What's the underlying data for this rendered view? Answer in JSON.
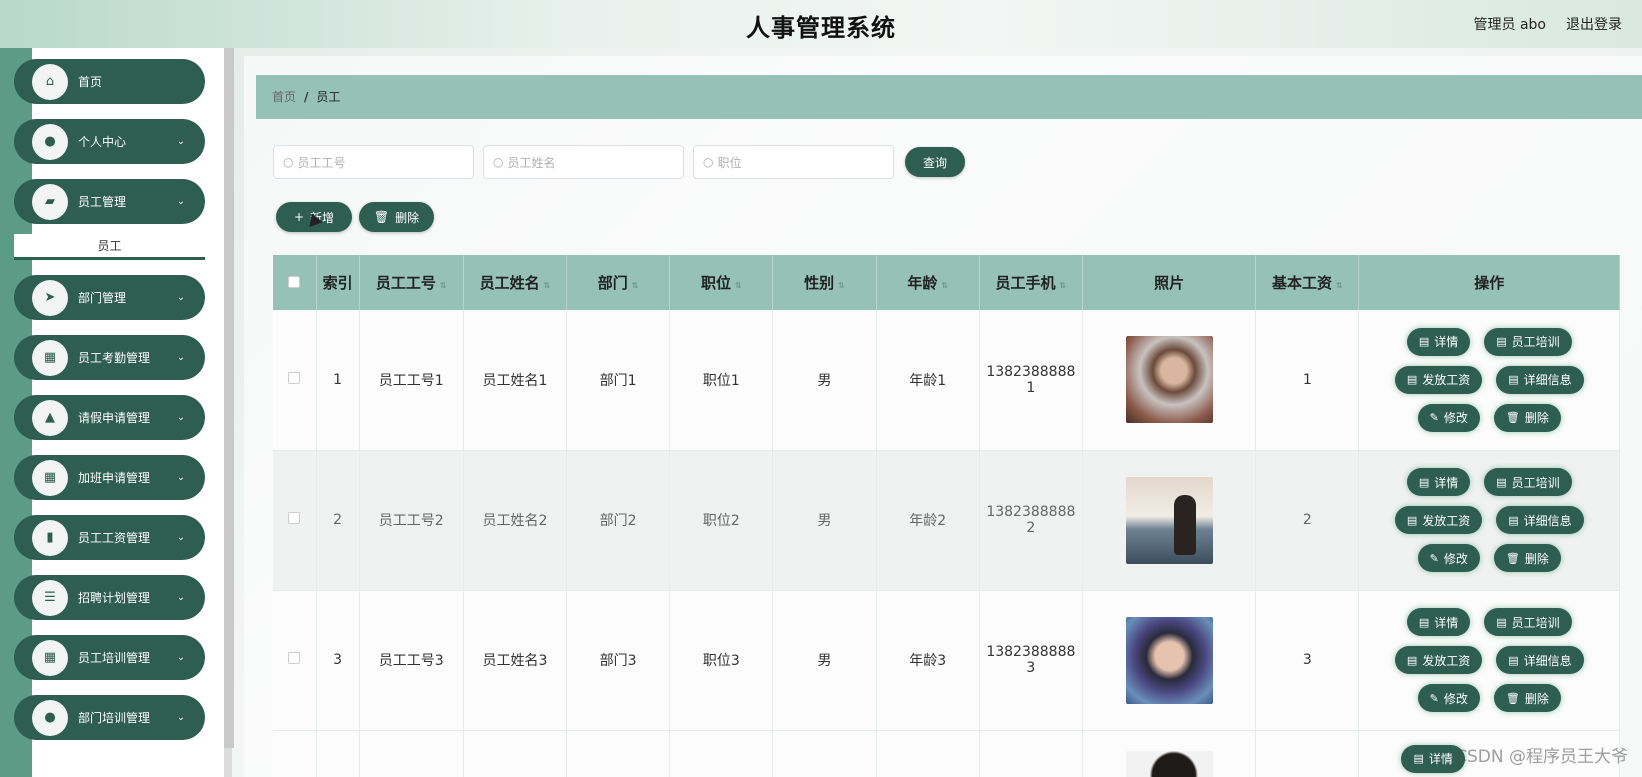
{
  "header": {
    "title": "人事管理系统",
    "user_label": "管理员 abo",
    "logout_label": "退出登录"
  },
  "sidebar": {
    "items": [
      {
        "label": "首页",
        "icon": "home-icon",
        "glyph": "⌂",
        "chevron": false
      },
      {
        "label": "个人中心",
        "icon": "user-icon",
        "glyph": "●",
        "chevron": true
      },
      {
        "label": "员工管理",
        "icon": "briefcase-icon",
        "glyph": "▰",
        "chevron": true
      },
      {
        "label": "部门管理",
        "icon": "send-icon",
        "glyph": "➤",
        "chevron": true
      },
      {
        "label": "员工考勤管理",
        "icon": "grid-icon",
        "glyph": "▦",
        "chevron": true
      },
      {
        "label": "请假申请管理",
        "icon": "stamp-icon",
        "glyph": "▲",
        "chevron": true
      },
      {
        "label": "加班申请管理",
        "icon": "grid-icon",
        "glyph": "▦",
        "chevron": true
      },
      {
        "label": "员工工资管理",
        "icon": "bar-chart-icon",
        "glyph": "▮",
        "chevron": true
      },
      {
        "label": "招聘计划管理",
        "icon": "list-icon",
        "glyph": "☰",
        "chevron": true
      },
      {
        "label": "员工培训管理",
        "icon": "grid-icon",
        "glyph": "▦",
        "chevron": true
      },
      {
        "label": "部门培训管理",
        "icon": "user-icon",
        "glyph": "●",
        "chevron": true
      }
    ],
    "submenu_label": "员工",
    "chevron_glyph": "⌄"
  },
  "breadcrumb": {
    "home": "首页",
    "separator": "/",
    "current": "员工"
  },
  "search": {
    "emp_no_placeholder": "员工工号",
    "emp_name_placeholder": "员工姓名",
    "position_placeholder": "职位",
    "query_label": "查询",
    "search_glyph": "○"
  },
  "toolbar": {
    "add_label": "新增",
    "add_glyph": "+",
    "delete_label": "删除",
    "delete_glyph": "🗑"
  },
  "table": {
    "columns": [
      "索引",
      "员工工号",
      "员工姓名",
      "部门",
      "职位",
      "性别",
      "年龄",
      "员工手机",
      "照片",
      "基本工资",
      "操作"
    ],
    "sort_glyph": "⇅",
    "rows": [
      {
        "index": "1",
        "emp_no": "员工工号1",
        "name": "员工姓名1",
        "dept": "部门1",
        "position": "职位1",
        "gender": "男",
        "age": "年龄1",
        "phone": "13823888881",
        "salary": "1"
      },
      {
        "index": "2",
        "emp_no": "员工工号2",
        "name": "员工姓名2",
        "dept": "部门2",
        "position": "职位2",
        "gender": "男",
        "age": "年龄2",
        "phone": "13823888882",
        "salary": "2"
      },
      {
        "index": "3",
        "emp_no": "员工工号3",
        "name": "员工姓名3",
        "dept": "部门3",
        "position": "职位3",
        "gender": "男",
        "age": "年龄3",
        "phone": "13823888883",
        "salary": "3"
      }
    ],
    "actions": {
      "detail": "详情",
      "training": "员工培训",
      "pay": "发放工资",
      "info": "详细信息",
      "edit": "修改",
      "delete": "删除"
    },
    "partial_row_action": "详情"
  },
  "watermark": "CSDN @程序员王大爷",
  "colors": {
    "primary": "#2e5e4f",
    "accent": "#95c2b4"
  }
}
